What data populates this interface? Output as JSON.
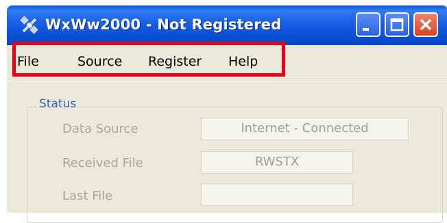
{
  "window": {
    "title": "WxWw2000 - Not Registered"
  },
  "menu": [
    "File",
    "Source",
    "Register",
    "Help"
  ],
  "status": {
    "group_label": "Status",
    "rows": [
      {
        "label": "Data Source",
        "value": "Internet - Connected"
      },
      {
        "label": "Received File",
        "value": "RWSTX"
      },
      {
        "label": "Last File",
        "value": ""
      }
    ]
  },
  "colors": {
    "highlight": "#e8001a",
    "group_label": "#2e63c6",
    "titlebar": "#0a53d8"
  },
  "icons": {
    "app": "satellite-icon",
    "minimize": "minimize-icon",
    "maximize": "maximize-icon",
    "close": "close-icon"
  }
}
